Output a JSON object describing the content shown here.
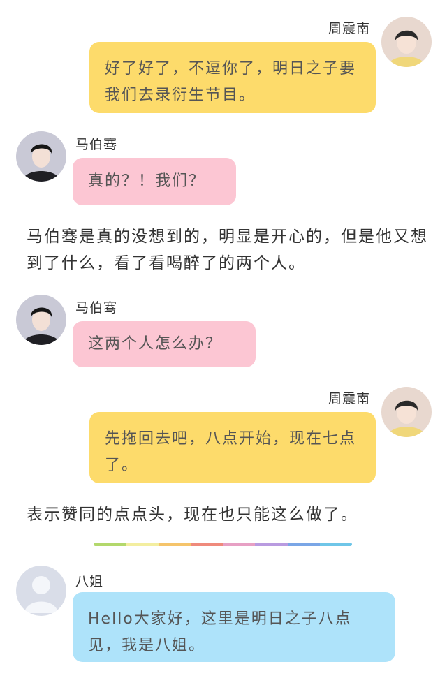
{
  "messages": [
    {
      "speaker": "周震南",
      "text": "好了好了，不逗你了，明日之子要我们去录衍生节目。",
      "avatar_icon": "portrait-avatar-zhou-icon"
    },
    {
      "speaker": "马伯骞",
      "text": "真的？！我们？",
      "avatar_icon": "portrait-avatar-ma-icon"
    },
    {
      "narration": "马伯骞是真的没想到的，明显是开心的，但是他又想到了什么，看了看喝醉了的两个人。"
    },
    {
      "speaker": "马伯骞",
      "text": "这两个人怎么办？",
      "avatar_icon": "portrait-avatar-ma-icon"
    },
    {
      "speaker": "周震南",
      "text": "先拖回去吧，八点开始，现在七点了。",
      "avatar_icon": "portrait-avatar-zhou-icon"
    },
    {
      "narration": "表示赞同的点点头，现在也只能这么做了。"
    },
    {
      "speaker": "八姐",
      "text": "Hello大家好，这里是明日之子八点见，我是八姐。",
      "avatar_icon": "default-user-avatar-icon"
    }
  ],
  "colors": {
    "bubble_yellow": "#fddb6b",
    "bubble_pink": "#fcc6d3",
    "bubble_blue": "#aee3fa",
    "divider": [
      "#b3d86c",
      "#f3eea0",
      "#f5c46b",
      "#ef8a7c",
      "#e7a0c4",
      "#b99be0",
      "#7aa6e6",
      "#6fc6e8"
    ]
  }
}
